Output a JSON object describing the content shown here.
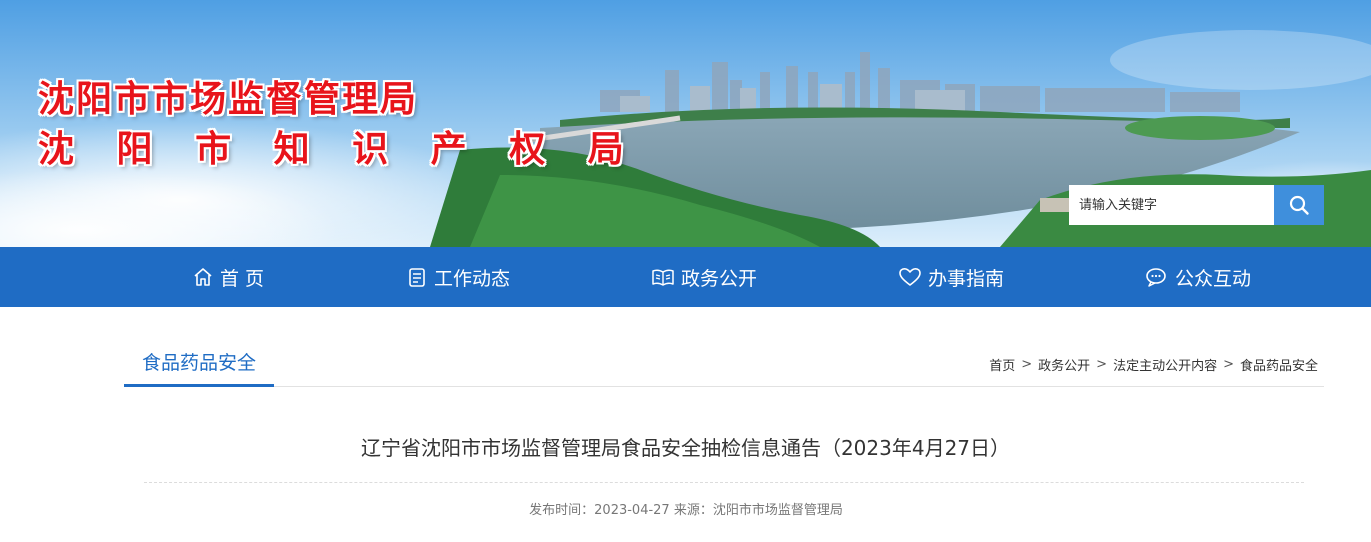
{
  "header": {
    "title_line1": "沈阳市市场监督管理局",
    "title_line2": "沈 阳 市 知 识 产 权 局",
    "search": {
      "placeholder": "请输入关键字",
      "button_icon": "search-icon"
    }
  },
  "nav": {
    "items": [
      {
        "label": "首 页",
        "icon": "home-icon"
      },
      {
        "label": "工作动态",
        "icon": "document-icon"
      },
      {
        "label": "政务公开",
        "icon": "book-icon"
      },
      {
        "label": "办事指南",
        "icon": "heart-icon"
      },
      {
        "label": "公众互动",
        "icon": "chat-icon"
      }
    ]
  },
  "section": {
    "title": "食品药品安全"
  },
  "breadcrumb": {
    "items": [
      "首页",
      "政务公开",
      "法定主动公开内容",
      "食品药品安全"
    ],
    "separator": ">"
  },
  "article": {
    "title": "辽宁省沈阳市市场监督管理局食品安全抽检信息通告（2023年4月27日）",
    "meta": "发布时间：2023-04-27 来源：沈阳市市场监督管理局"
  },
  "colors": {
    "nav_bg": "#1f6cc4",
    "title_red": "#e8141b",
    "accent": "#1f6cc4"
  }
}
